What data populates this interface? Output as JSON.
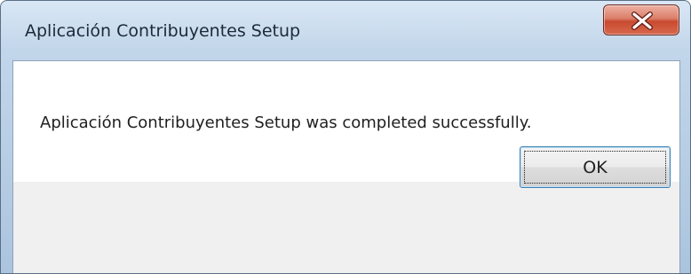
{
  "window": {
    "title": "Aplicación Contribuyentes Setup",
    "close_icon": "close-icon"
  },
  "message": {
    "text": "Aplicación Contribuyentes Setup was completed successfully."
  },
  "buttons": {
    "ok_label": "OK"
  },
  "colors": {
    "titlebar": "#c2d6ea",
    "close_button": "#c84a30",
    "button_area": "#f0f0f0",
    "focus_border": "#3c7fb1"
  }
}
